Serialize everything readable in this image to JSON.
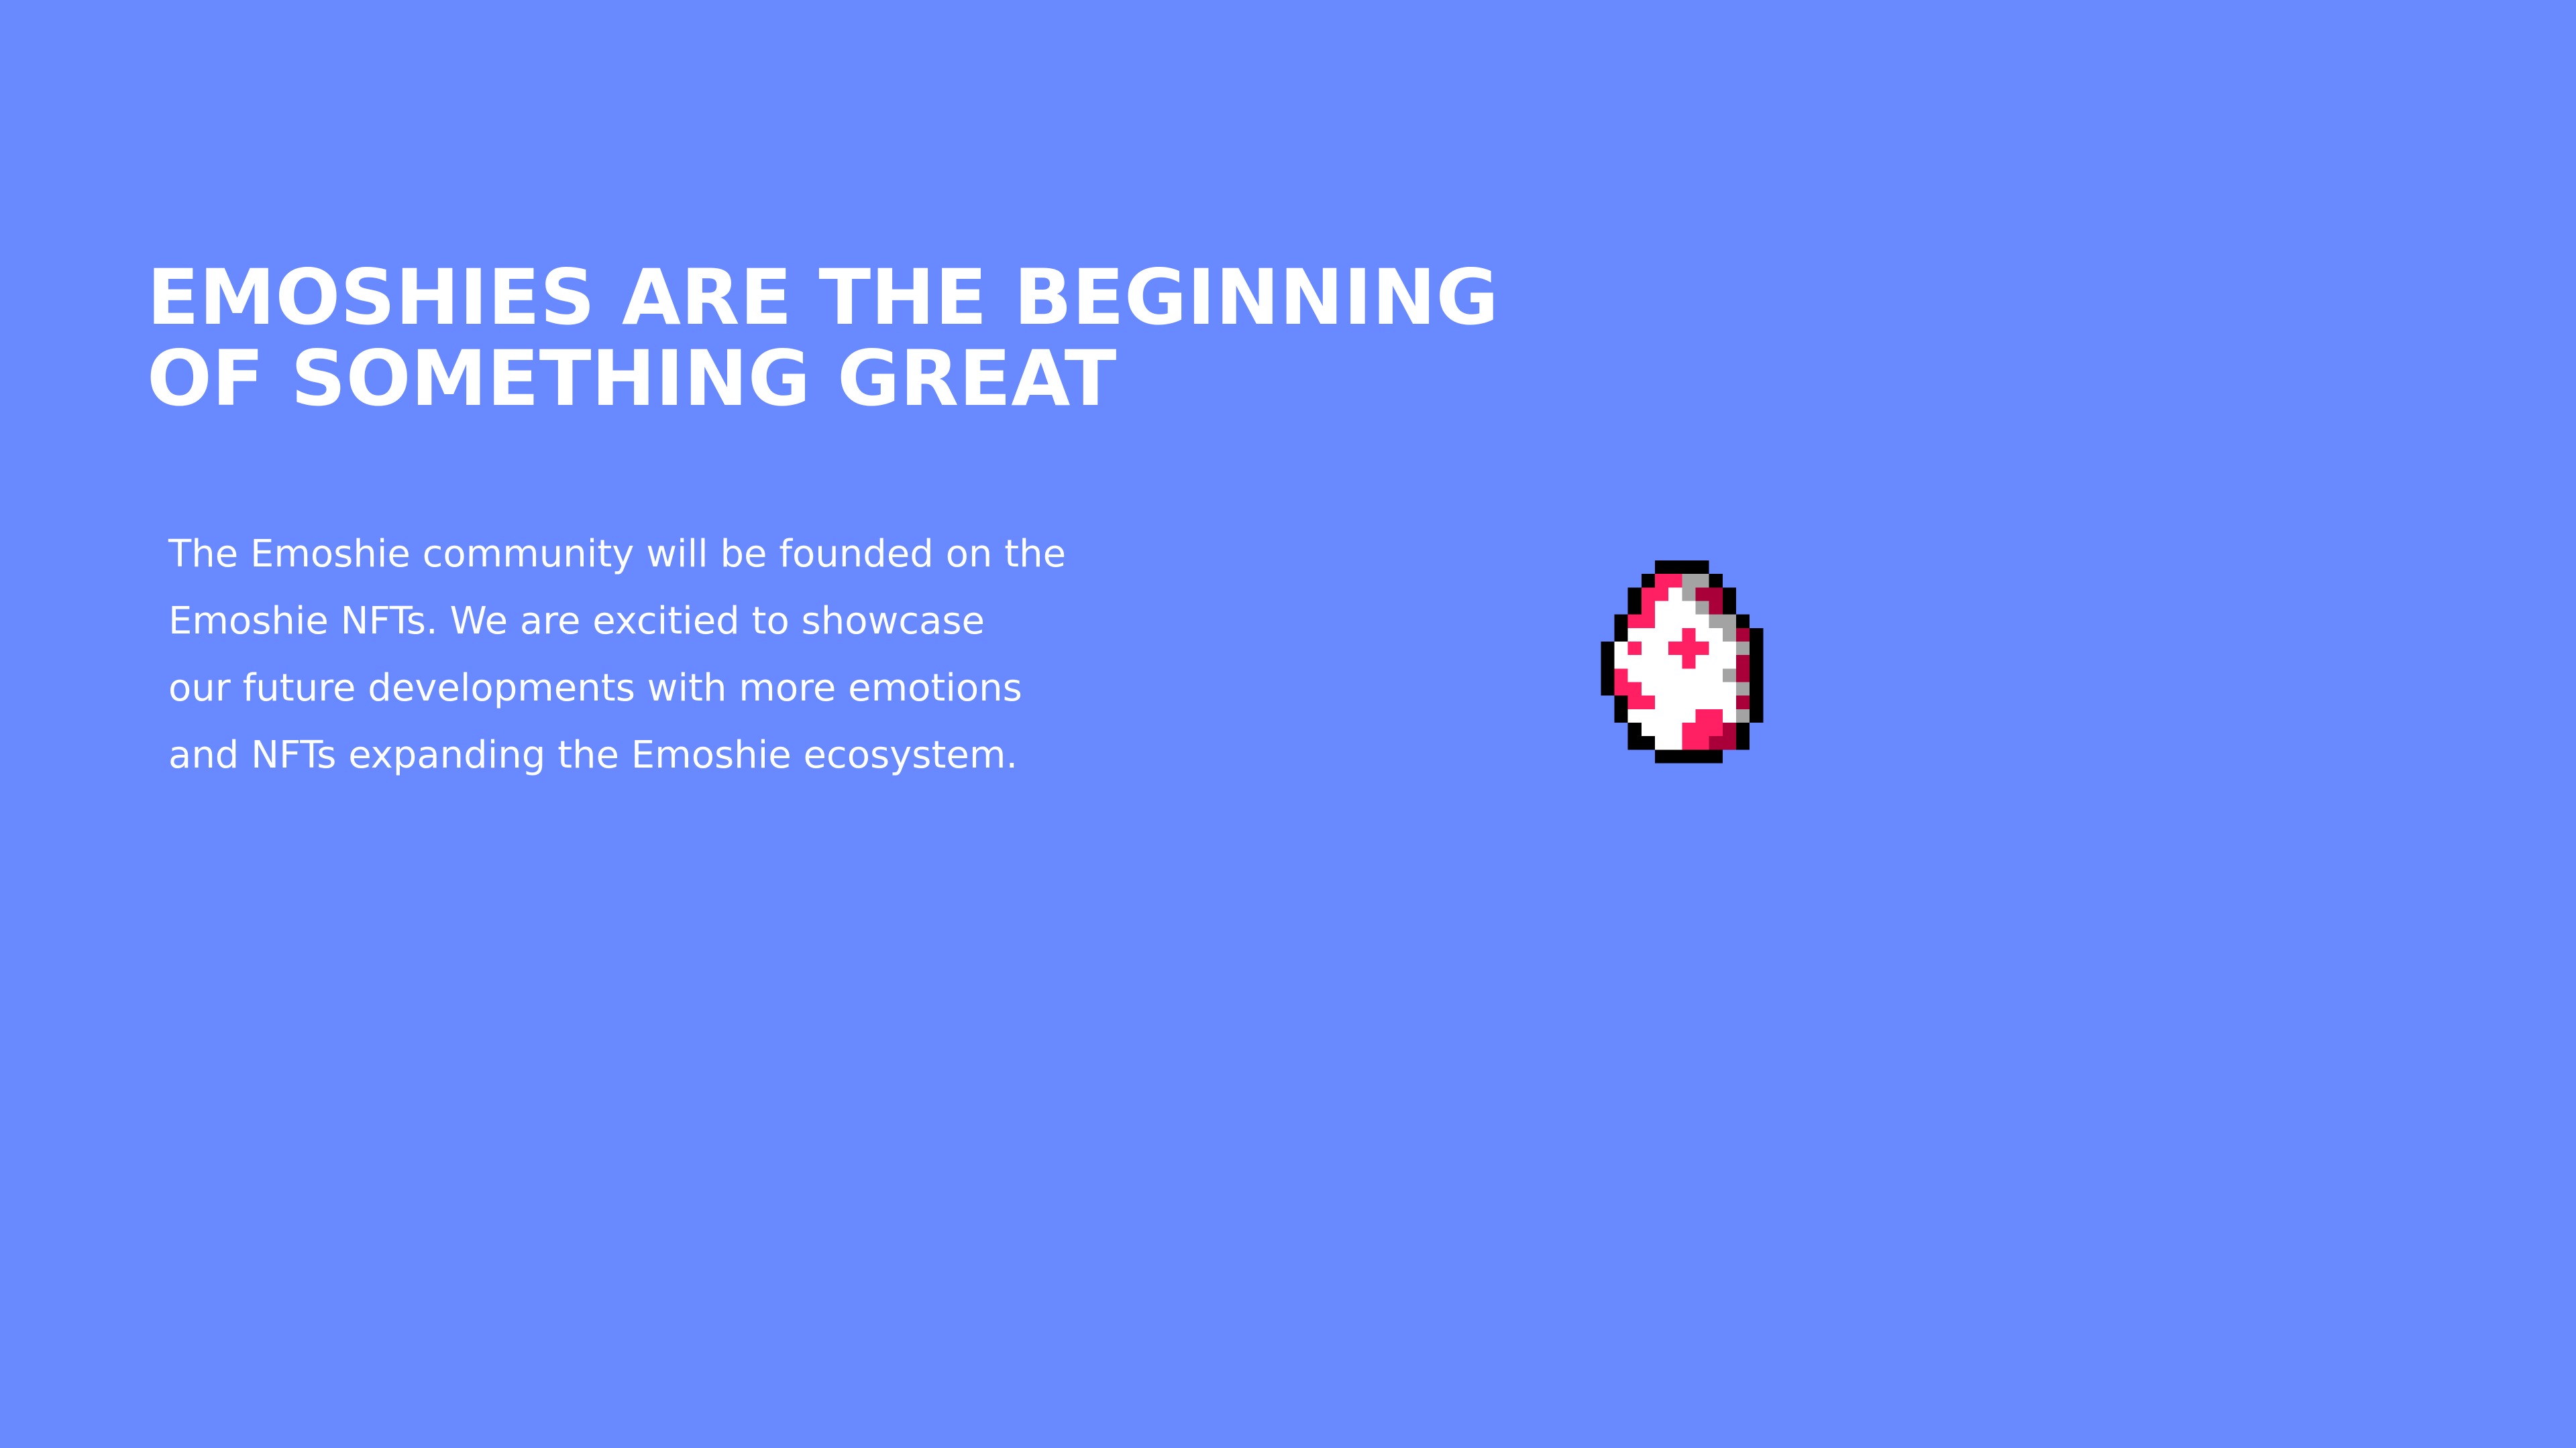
{
  "section": {
    "headline": "EMOSHIES ARE THE BEGINNING\nOF SOMETHING GREAT",
    "body": "The Emoshie community will be founded on the\nEmoshie NFTs. We are excitied to showcase\nour future developments with more emotions\nand NFTs expanding the Emoshie ecosystem.",
    "illustration": {
      "icon": "pixel-egg-icon",
      "palette": {
        "outline": "#000000",
        "shell": "#ffffff",
        "shadow": "#a3a3a3",
        "spot": "#ff1f62",
        "spot_shadow": "#a90039"
      }
    }
  },
  "colors": {
    "background": "#6889ff",
    "text": "#ffffff"
  }
}
